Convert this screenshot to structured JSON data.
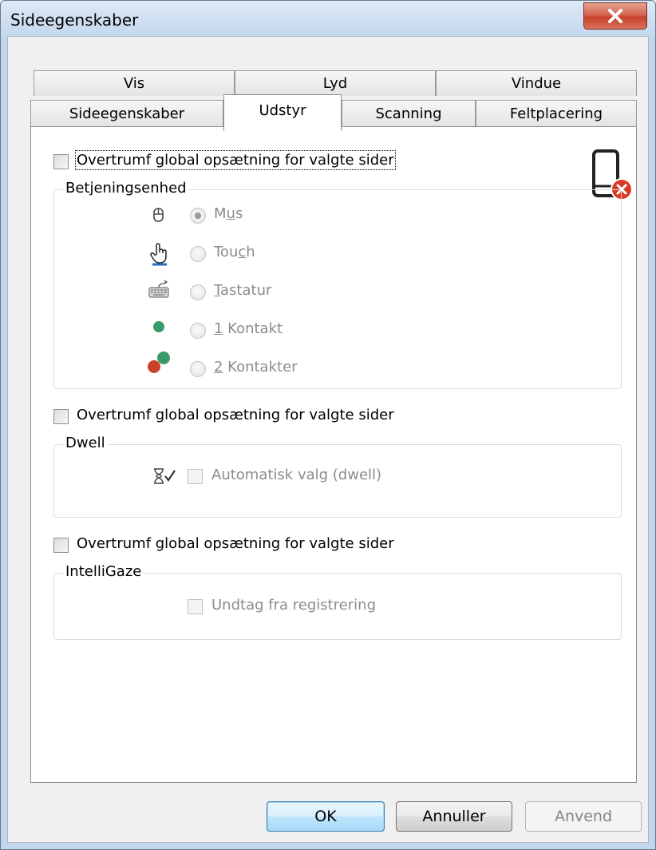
{
  "window": {
    "title": "Sideegenskaber"
  },
  "tabs": {
    "row1": [
      {
        "label": "Vis"
      },
      {
        "label": "Lyd"
      },
      {
        "label": "Vindue"
      }
    ],
    "row2": [
      {
        "label": "Sideegenskaber"
      },
      {
        "label": "Udstyr"
      },
      {
        "label": "Scanning"
      },
      {
        "label": "Feltplacering"
      }
    ],
    "active": "Udstyr"
  },
  "device_section": {
    "override_label": "Overtrumf global opsætning for valgte sider",
    "override_checked": false,
    "group_title": "Betjeningsenhed",
    "status_icon": "phone-error-icon",
    "options": [
      {
        "label": "Mus",
        "icon": "mouse-icon",
        "selected": true,
        "mnemonic": "u"
      },
      {
        "label": "Touch",
        "icon": "touch-hand-icon",
        "selected": false,
        "mnemonic": "c"
      },
      {
        "label": "Tastatur",
        "icon": "keyboard-icon",
        "selected": false,
        "mnemonic": "T"
      },
      {
        "label": "1 Kontakt",
        "icon": "one-switch-icon",
        "selected": false,
        "mnemonic": "1"
      },
      {
        "label": "2 Kontakter",
        "icon": "two-switches-icon",
        "selected": false,
        "mnemonic": "2"
      }
    ]
  },
  "dwell_section": {
    "override_label": "Overtrumf global opsætning for valgte sider",
    "override_checked": false,
    "group_title": "Dwell",
    "auto_select_label": "Automatisk valg (dwell)",
    "auto_select_checked": false
  },
  "intelligaze_section": {
    "override_label": "Overtrumf global opsætning for valgte sider",
    "override_checked": false,
    "group_title": "IntelliGaze",
    "exclude_label": "Undtag fra registrering",
    "exclude_checked": false
  },
  "buttons": {
    "ok": "OK",
    "cancel": "Annuller",
    "apply": "Anvend"
  },
  "colors": {
    "switch_green": "#3a9a6a",
    "switch_red": "#c9412b",
    "error_red": "#d93a25",
    "close_red": "#c7412a"
  }
}
